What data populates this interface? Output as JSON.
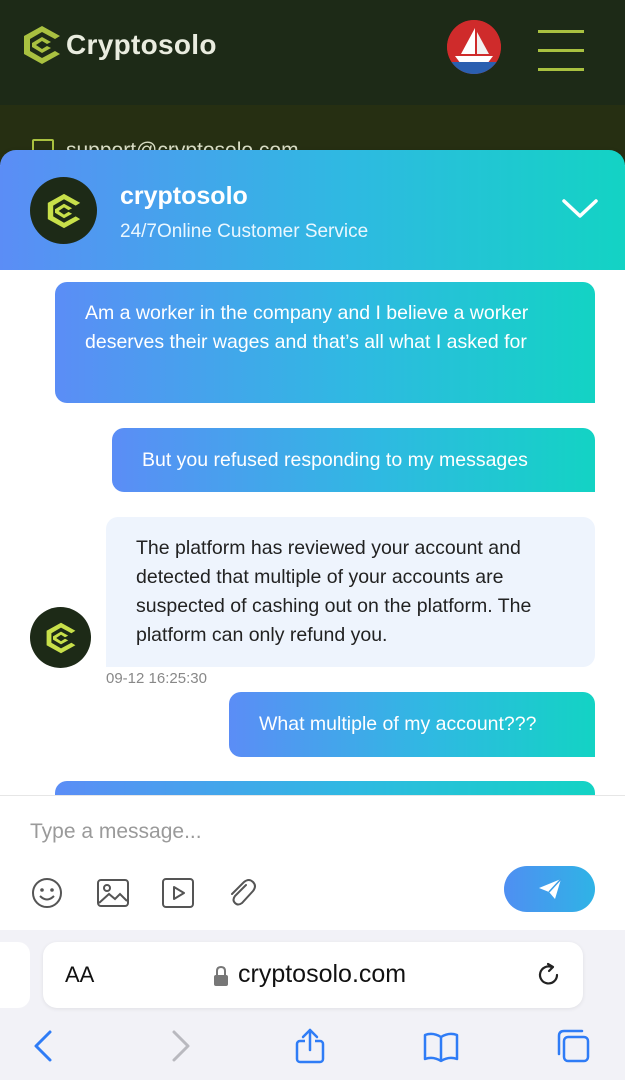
{
  "site": {
    "logo_text": "Cryptosolo",
    "support_email": "support@cryptosolo.com"
  },
  "chat": {
    "agent_name": "cryptosolo",
    "agent_subtitle": "24/7Online Customer Service",
    "messages": [
      {
        "direction": "out",
        "text": "Am a worker in the company and I believe a worker deserves their wages and that’s all what I asked for"
      },
      {
        "direction": "out",
        "text": "But you refused responding to my messages"
      },
      {
        "direction": "in",
        "text": "The platform has reviewed your account and detected that multiple of your accounts are suspected of cashing out on the platform. The platform can only refund you.",
        "time": "09-12 16:25:30"
      },
      {
        "direction": "out",
        "text": "What multiple of my account???"
      }
    ],
    "composer": {
      "placeholder": "Type a message..."
    }
  },
  "browser": {
    "aa_label": "AA",
    "url": "cryptosolo.com"
  },
  "icons": [
    "mail-icon",
    "chevron-down-icon",
    "emoji-icon",
    "image-icon",
    "video-icon",
    "attachment-icon",
    "send-icon",
    "lock-icon",
    "reload-icon",
    "back-icon",
    "forward-icon",
    "share-icon",
    "bookmarks-icon",
    "tabs-icon"
  ],
  "colors": {
    "header_dark": "#1d2a17",
    "brand_lime": "#a9c140",
    "gradient_start": "#5b8df6",
    "gradient_end": "#13d3c4",
    "incoming_bubble": "#eef4fd",
    "ios_blue": "#2f7cf6"
  }
}
